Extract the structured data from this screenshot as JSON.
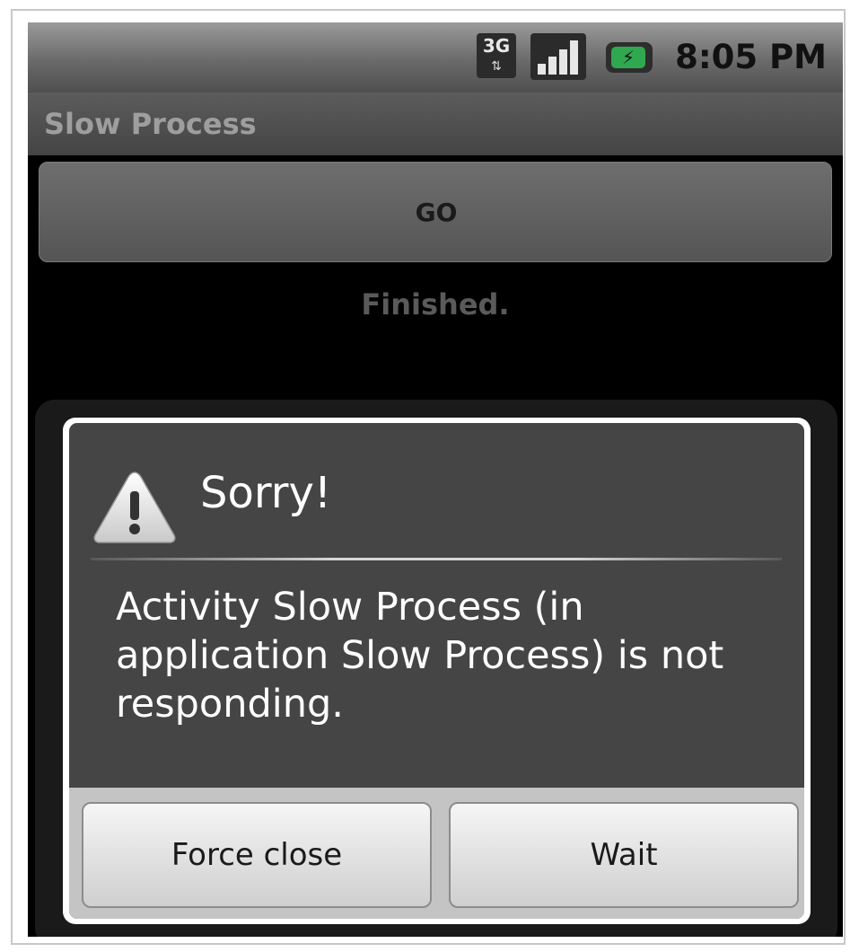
{
  "status_bar": {
    "network_label": "3G",
    "network_arrows": "⇅",
    "network_icon": "3g-data-icon",
    "signal_icon": "signal-strength-icon",
    "signal_bars_filled": 4,
    "battery_icon": "battery-charging-icon",
    "battery_bolt": "⚡",
    "battery_color": "#2fa84f",
    "time": "8:05 PM"
  },
  "app": {
    "title": "Slow Process",
    "go_button_label": "GO",
    "status_text": "Finished."
  },
  "dialog": {
    "icon": "warning-icon",
    "title": "Sorry!",
    "message": "Activity Slow Process (in application Slow Process) is not responding.",
    "buttons": [
      {
        "label": "Force close"
      },
      {
        "label": "Wait"
      }
    ]
  }
}
